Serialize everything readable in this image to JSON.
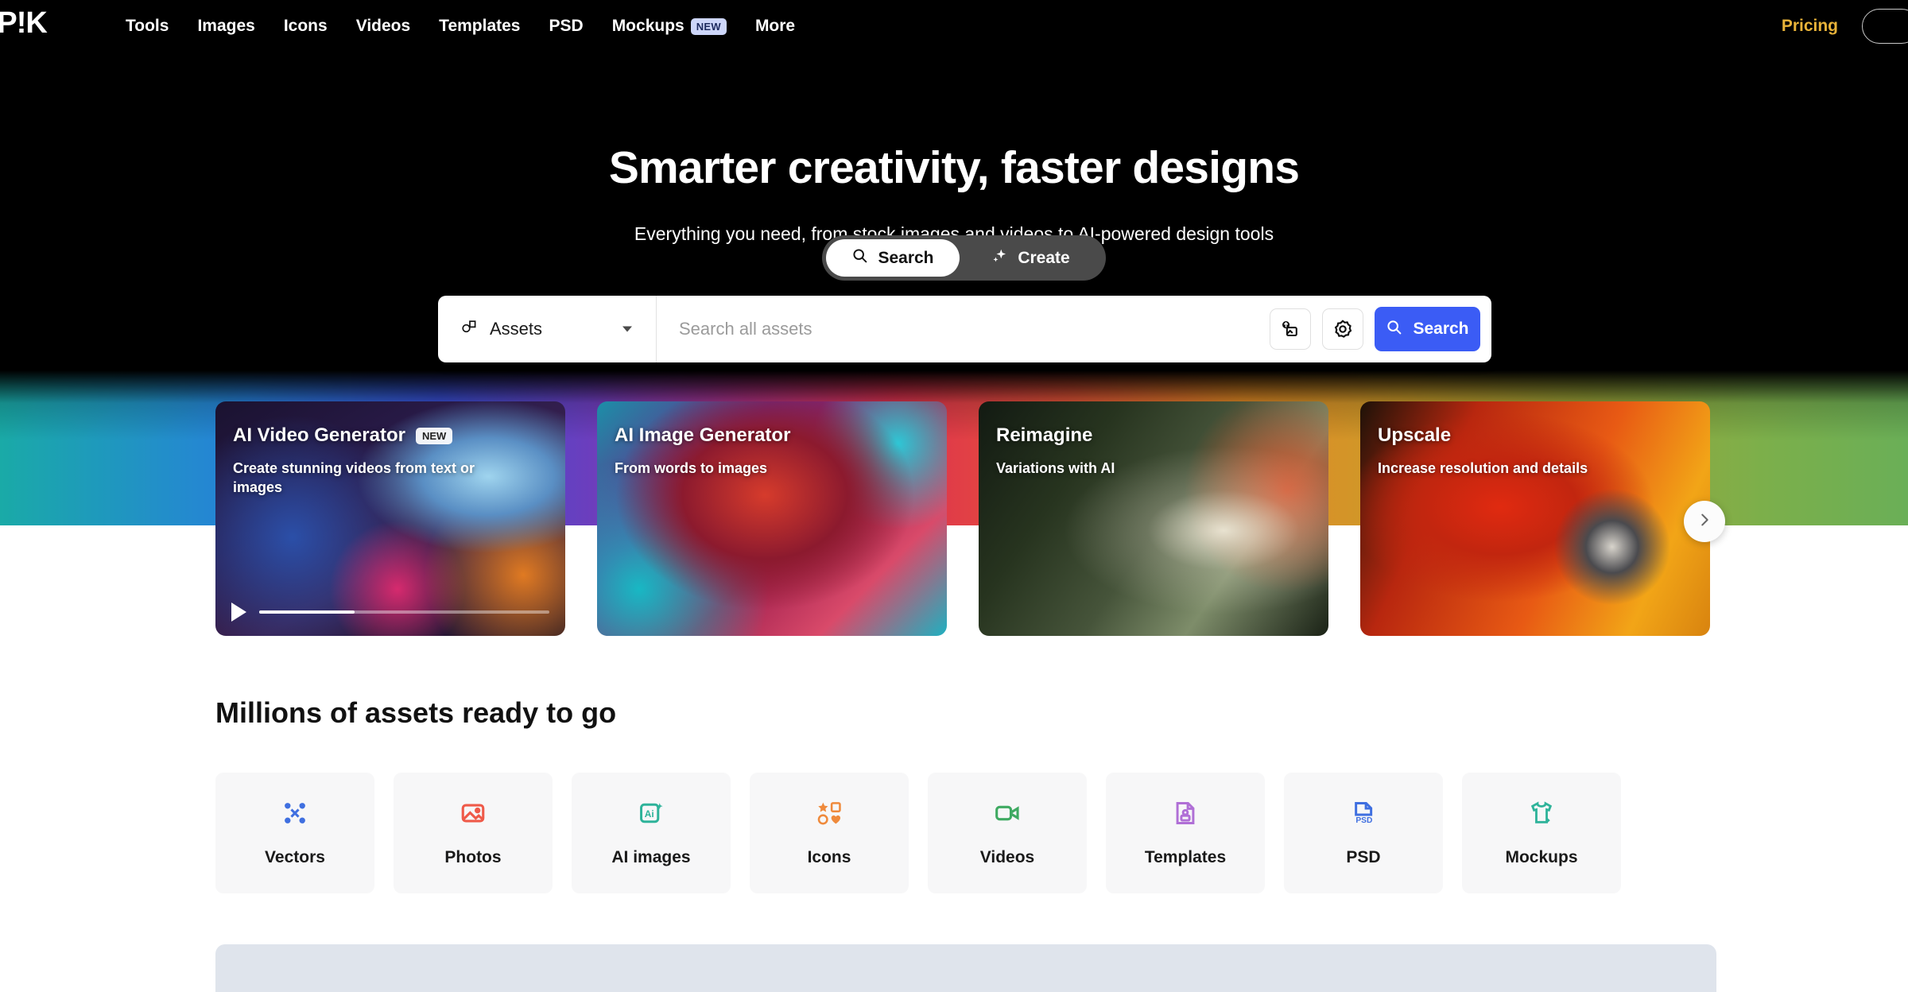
{
  "header": {
    "logo": "EP!K",
    "nav": [
      {
        "label": "Tools",
        "badge": null
      },
      {
        "label": "Images",
        "badge": null
      },
      {
        "label": "Icons",
        "badge": null
      },
      {
        "label": "Videos",
        "badge": null
      },
      {
        "label": "Templates",
        "badge": null
      },
      {
        "label": "PSD",
        "badge": null
      },
      {
        "label": "Mockups",
        "badge": "NEW"
      },
      {
        "label": "More",
        "badge": null
      }
    ],
    "pricing_label": "Pricing",
    "pricing_color": "#e8b339"
  },
  "hero": {
    "title": "Smarter creativity, faster designs",
    "subtitle": "Everything you need, from stock images and videos to AI-powered design tools",
    "toggle": {
      "search_label": "Search",
      "create_label": "Create",
      "active": "Search"
    },
    "searchbar": {
      "asset_type": "Assets",
      "placeholder": "Search all assets",
      "value": "",
      "search_button_label": "Search",
      "search_button_color": "#3b5cf5"
    }
  },
  "carousel": {
    "cards": [
      {
        "title": "AI Video Generator",
        "badge": "NEW",
        "description": "Create stunning videos from text or images",
        "has_video": true,
        "progress_percent": 33
      },
      {
        "title": "AI Image Generator",
        "badge": null,
        "description": "From words to images",
        "has_video": false,
        "progress_percent": 0
      },
      {
        "title": "Reimagine",
        "badge": null,
        "description": "Variations with AI",
        "has_video": false,
        "progress_percent": 0
      },
      {
        "title": "Upscale",
        "badge": null,
        "description": "Increase resolution and details",
        "has_video": false,
        "progress_percent": 0
      }
    ]
  },
  "assets_section": {
    "title": "Millions of assets ready to go",
    "tiles": [
      {
        "label": "Vectors",
        "icon": "vector-nodes-icon",
        "color": "#3f6fe0"
      },
      {
        "label": "Photos",
        "icon": "photo-icon",
        "color": "#ef5a49"
      },
      {
        "label": "AI images",
        "icon": "ai-image-icon",
        "color": "#2eb39a"
      },
      {
        "label": "Icons",
        "icon": "shapes-icon",
        "color": "#ef8a3c"
      },
      {
        "label": "Videos",
        "icon": "camcorder-icon",
        "color": "#3faa62"
      },
      {
        "label": "Templates",
        "icon": "template-doc-icon",
        "color": "#b06fd6"
      },
      {
        "label": "PSD",
        "icon": "psd-file-icon",
        "color": "#3f6fe0"
      },
      {
        "label": "Mockups",
        "icon": "tshirt-icon",
        "color": "#2eb39a"
      }
    ]
  }
}
